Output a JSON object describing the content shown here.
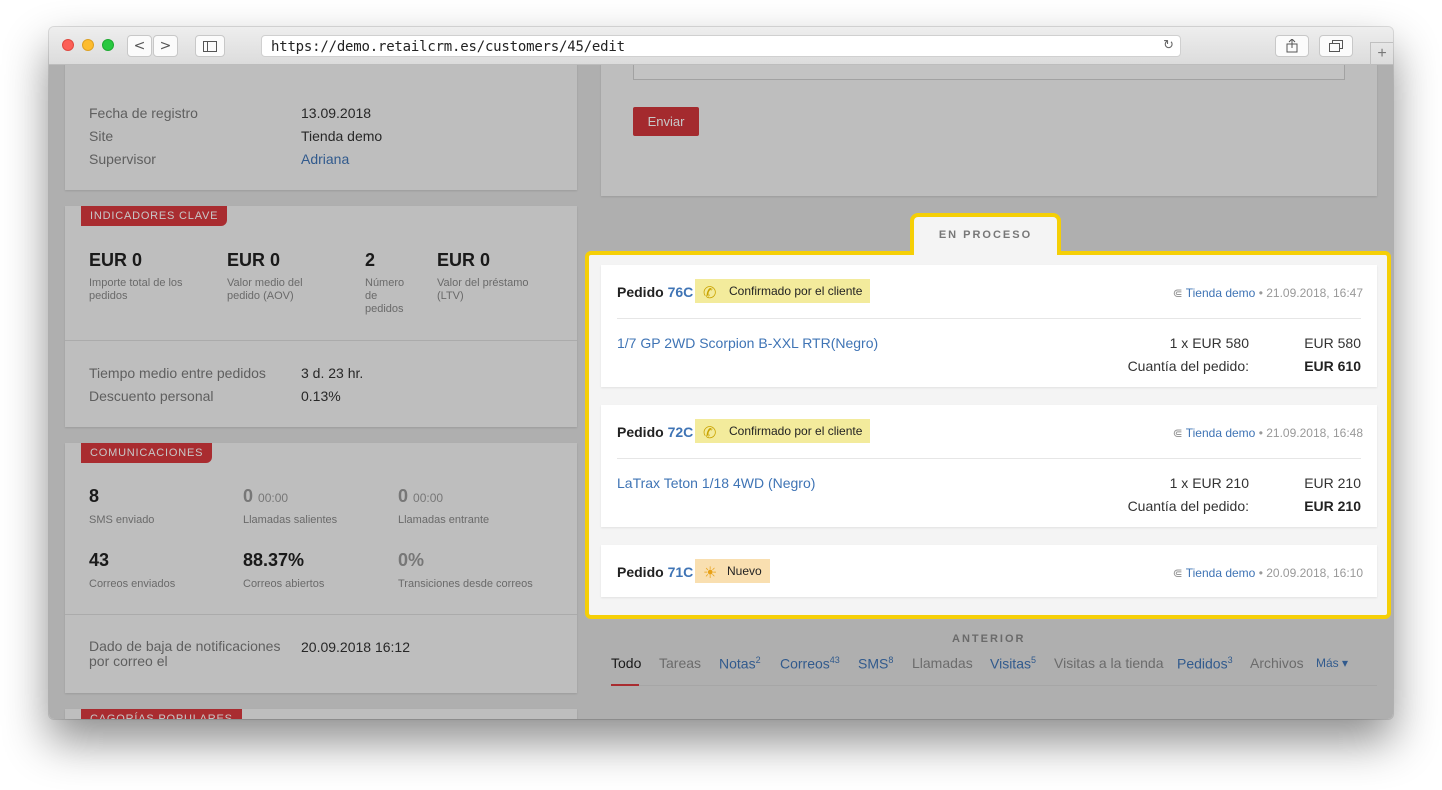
{
  "browser": {
    "url": "https://demo.retailcrm.es/customers/45/edit",
    "back": "<",
    "forward": ">",
    "reload": "↻",
    "new_tab": "+"
  },
  "customer_info": {
    "rows": [
      {
        "label": "Fecha de registro",
        "value": "13.09.2018"
      },
      {
        "label": "Site",
        "value": "Tienda demo"
      },
      {
        "label": "Supervisor",
        "value": "Adriana"
      }
    ]
  },
  "key_indicators": {
    "tag": "INDICADORES CLAVE",
    "metrics": [
      {
        "value": "EUR 0",
        "label": "Importe total de los pedidos"
      },
      {
        "value": "EUR 0",
        "label": "Valor medio del pedido (AOV)"
      },
      {
        "value": "2",
        "label": "Número de pedidos"
      },
      {
        "value": "EUR 0",
        "label": "Valor del préstamo (LTV)"
      }
    ],
    "rows": [
      {
        "label": "Tiempo medio entre pedidos",
        "value": "3 d. 23 hr."
      },
      {
        "label": "Descuento personal",
        "value": "0.13%"
      }
    ]
  },
  "communications": {
    "tag": "COMUNICACIONES",
    "metrics": [
      {
        "value": "8",
        "extra": "",
        "label": "SMS enviado"
      },
      {
        "value": "0",
        "extra": "00:00",
        "label": "Llamadas salientes"
      },
      {
        "value": "0",
        "extra": "00:00",
        "label": "Llamadas entrante"
      },
      {
        "value": "43",
        "extra": "",
        "label": "Correos enviados"
      },
      {
        "value": "88.37%",
        "extra": "",
        "label": "Correos abiertos"
      },
      {
        "value": "0%",
        "extra": "",
        "label": "Transiciones desde correos"
      }
    ],
    "unsubscribe_label": "Dado de baja de notificaciones por correo el",
    "unsubscribe_value": "20.09.2018 16:12"
  },
  "popular_tag": "CAGORÍAS POPULARES",
  "send_button": "Enviar",
  "in_process": {
    "label": "EN PROCESO",
    "orders": [
      {
        "prefix": "Pedido",
        "number": "76C",
        "status": "Confirmado por el cliente",
        "status_icon": "phone-icon",
        "store": "Tienda demo",
        "date": "• 21.09.2018, 16:47",
        "item": "1/7 GP 2WD Scorpion B-XXL RTR(Negro)",
        "qty": "1 x EUR 580",
        "price": "EUR 580",
        "total_label": "Cuantía del pedido:",
        "total": "EUR 610"
      },
      {
        "prefix": "Pedido",
        "number": "72C",
        "status": "Confirmado por el cliente",
        "status_icon": "phone-icon",
        "store": "Tienda demo",
        "date": "• 21.09.2018, 16:48",
        "item": "LaTrax Teton 1/18 4WD (Negro)",
        "qty": "1 x EUR 210",
        "price": "EUR 210",
        "total_label": "Cuantía del pedido:",
        "total": "EUR 210"
      },
      {
        "prefix": "Pedido",
        "number": "71C",
        "status": "Nuevo",
        "status_icon": "lightbulb-icon",
        "store": "Tienda demo",
        "date": "• 20.09.2018, 16:10"
      }
    ]
  },
  "previous_label": "ANTERIOR",
  "tabs": [
    {
      "label": "Todo",
      "count": ""
    },
    {
      "label": "Tareas",
      "count": ""
    },
    {
      "label": "Notas",
      "count": "2"
    },
    {
      "label": "Correos",
      "count": "43"
    },
    {
      "label": "SMS",
      "count": "8"
    },
    {
      "label": "Llamadas",
      "count": ""
    },
    {
      "label": "Visitas",
      "count": "5"
    },
    {
      "label": "Visitas a la tienda",
      "count": ""
    },
    {
      "label": "Pedidos",
      "count": "3"
    },
    {
      "label": "Archivos",
      "count": ""
    },
    {
      "label": "Más ▾",
      "count": ""
    }
  ],
  "colors": {
    "accent": "#d9393e",
    "link": "#3f74b5",
    "highlight": "#f5cf06",
    "status_confirmed": "#f3eb9c",
    "status_new": "#f9dfb0"
  }
}
